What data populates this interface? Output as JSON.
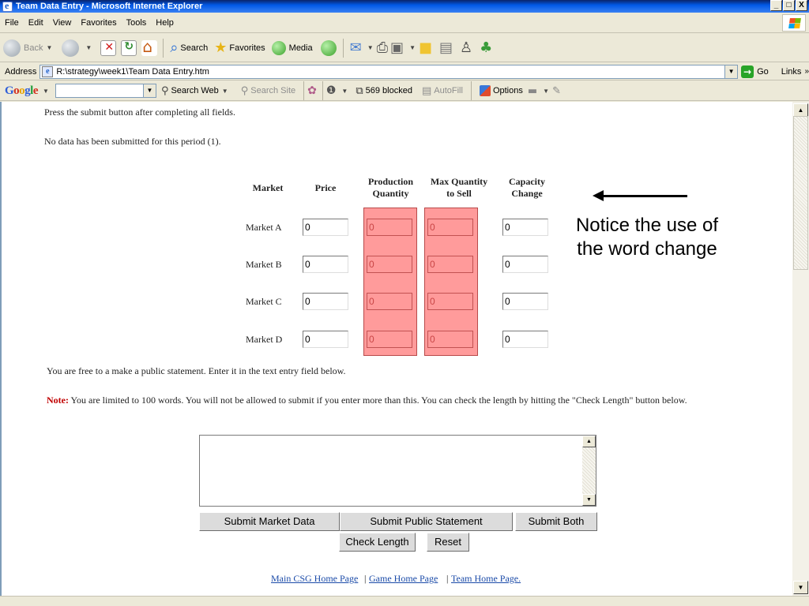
{
  "window": {
    "title": "Team Data Entry - Microsoft Internet Explorer",
    "controls": {
      "minimize": "_",
      "maximize": "□",
      "close": "X"
    }
  },
  "menu": [
    "File",
    "Edit",
    "View",
    "Favorites",
    "Tools",
    "Help"
  ],
  "toolbar": {
    "back": "Back",
    "search": "Search",
    "favorites": "Favorites",
    "media": "Media"
  },
  "address": {
    "label": "Address",
    "value": "R:\\strategy\\week1\\Team Data Entry.htm",
    "go": "Go",
    "links": "Links"
  },
  "google_bar": {
    "logo": [
      "G",
      "o",
      "o",
      "g",
      "l",
      "e"
    ],
    "search_web": "Search Web",
    "search_site": "Search Site",
    "blocked": "569 blocked",
    "autofill": "AutoFill",
    "options": "Options"
  },
  "page": {
    "instruction": "Press the submit button after completing all fields.",
    "status": "No data has been submitted for this period (1).",
    "table": {
      "headers": {
        "market": "Market",
        "price": "Price",
        "production": [
          "Production",
          "Quantity"
        ],
        "maxsell": [
          "Max Quantity",
          "to Sell"
        ],
        "capacity": [
          "Capacity",
          "Change"
        ]
      },
      "rows": [
        {
          "label": "Market A",
          "price": "0",
          "production": "0",
          "maxsell": "0",
          "capacity": "0"
        },
        {
          "label": "Market B",
          "price": "0",
          "production": "0",
          "maxsell": "0",
          "capacity": "0"
        },
        {
          "label": "Market C",
          "price": "0",
          "production": "0",
          "maxsell": "0",
          "capacity": "0"
        },
        {
          "label": "Market D",
          "price": "0",
          "production": "0",
          "maxsell": "0",
          "capacity": "0"
        }
      ]
    },
    "callout": [
      "Notice the use of",
      "the word change"
    ],
    "public_statement": "You are free to a make a public statement. Enter it in the text entry field below.",
    "note_label": "Note:",
    "note_text": " You are limited to 100 words. You will not be allowed to submit if you enter more than this. You can check the length by hitting the \"Check Length\" button below.",
    "buttons": {
      "submit_market": "Submit Market Data",
      "submit_public": "Submit Public Statement",
      "submit_both": "Submit Both",
      "check_length": "Check Length",
      "reset": "Reset"
    },
    "footer_links": [
      "Main CSG Home Page",
      "Game Home Page",
      "Team Home Page."
    ],
    "footer_sep": "|"
  },
  "colors": {
    "highlight": "#ff9a9a",
    "link": "#1a4aa8",
    "note": "#c00000"
  }
}
